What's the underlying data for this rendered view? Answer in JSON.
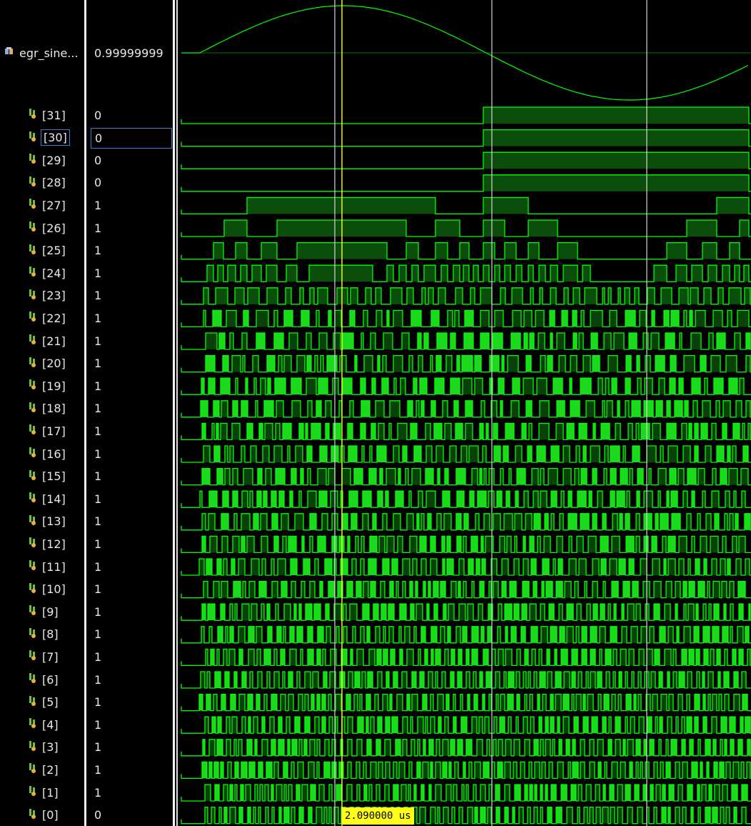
{
  "signals": [
    {
      "name": "egr_sine...",
      "value": "0.99999999",
      "kind": "analog",
      "icon": "analog-bus-icon"
    },
    {
      "name": "[31]",
      "value": "0",
      "kind": "bit",
      "icon": "wire-bit-icon"
    },
    {
      "name": "[30]",
      "value": "0",
      "kind": "bit",
      "icon": "wire-bit-icon",
      "selected": true
    },
    {
      "name": "[29]",
      "value": "0",
      "kind": "bit",
      "icon": "wire-bit-icon"
    },
    {
      "name": "[28]",
      "value": "0",
      "kind": "bit",
      "icon": "wire-bit-icon"
    },
    {
      "name": "[27]",
      "value": "1",
      "kind": "bit",
      "icon": "wire-bit-icon"
    },
    {
      "name": "[26]",
      "value": "1",
      "kind": "bit",
      "icon": "wire-bit-icon"
    },
    {
      "name": "[25]",
      "value": "1",
      "kind": "bit",
      "icon": "wire-bit-icon"
    },
    {
      "name": "[24]",
      "value": "1",
      "kind": "bit",
      "icon": "wire-bit-icon"
    },
    {
      "name": "[23]",
      "value": "1",
      "kind": "bit",
      "icon": "wire-bit-icon"
    },
    {
      "name": "[22]",
      "value": "1",
      "kind": "bit",
      "icon": "wire-bit-icon"
    },
    {
      "name": "[21]",
      "value": "1",
      "kind": "bit",
      "icon": "wire-bit-icon"
    },
    {
      "name": "[20]",
      "value": "1",
      "kind": "bit",
      "icon": "wire-bit-icon"
    },
    {
      "name": "[19]",
      "value": "1",
      "kind": "bit",
      "icon": "wire-bit-icon"
    },
    {
      "name": "[18]",
      "value": "1",
      "kind": "bit",
      "icon": "wire-bit-icon"
    },
    {
      "name": "[17]",
      "value": "1",
      "kind": "bit",
      "icon": "wire-bit-icon"
    },
    {
      "name": "[16]",
      "value": "1",
      "kind": "bit",
      "icon": "wire-bit-icon"
    },
    {
      "name": "[15]",
      "value": "1",
      "kind": "bit",
      "icon": "wire-bit-icon"
    },
    {
      "name": "[14]",
      "value": "1",
      "kind": "bit",
      "icon": "wire-bit-icon"
    },
    {
      "name": "[13]",
      "value": "1",
      "kind": "bit",
      "icon": "wire-bit-icon"
    },
    {
      "name": "[12]",
      "value": "1",
      "kind": "bit",
      "icon": "wire-bit-icon"
    },
    {
      "name": "[11]",
      "value": "1",
      "kind": "bit",
      "icon": "wire-bit-icon"
    },
    {
      "name": "[10]",
      "value": "1",
      "kind": "bit",
      "icon": "wire-bit-icon"
    },
    {
      "name": "[9]",
      "value": "1",
      "kind": "bit",
      "icon": "wire-bit-icon"
    },
    {
      "name": "[8]",
      "value": "1",
      "kind": "bit",
      "icon": "wire-bit-icon"
    },
    {
      "name": "[7]",
      "value": "1",
      "kind": "bit",
      "icon": "wire-bit-icon"
    },
    {
      "name": "[6]",
      "value": "1",
      "kind": "bit",
      "icon": "wire-bit-icon"
    },
    {
      "name": "[5]",
      "value": "1",
      "kind": "bit",
      "icon": "wire-bit-icon"
    },
    {
      "name": "[4]",
      "value": "1",
      "kind": "bit",
      "icon": "wire-bit-icon"
    },
    {
      "name": "[3]",
      "value": "1",
      "kind": "bit",
      "icon": "wire-bit-icon"
    },
    {
      "name": "[2]",
      "value": "1",
      "kind": "bit",
      "icon": "wire-bit-icon"
    },
    {
      "name": "[1]",
      "value": "1",
      "kind": "bit",
      "icon": "wire-bit-icon"
    },
    {
      "name": "[0]",
      "value": "0",
      "kind": "bit",
      "icon": "wire-bit-icon"
    }
  ],
  "cursor": {
    "label": "2.090000 us"
  },
  "colors": {
    "waveform": "#00ff00",
    "waveform_fill": "#0b4d0b",
    "waveform_dense": "#22ff22",
    "cursor_line": "#ffff33",
    "marker_line": "#d8d8d8",
    "cursor_label_bg": "#ffff1a",
    "selection_outline": "#3a7bd5",
    "background": "#000000"
  },
  "sine_wave": {
    "shape": "sine",
    "shown": true
  }
}
